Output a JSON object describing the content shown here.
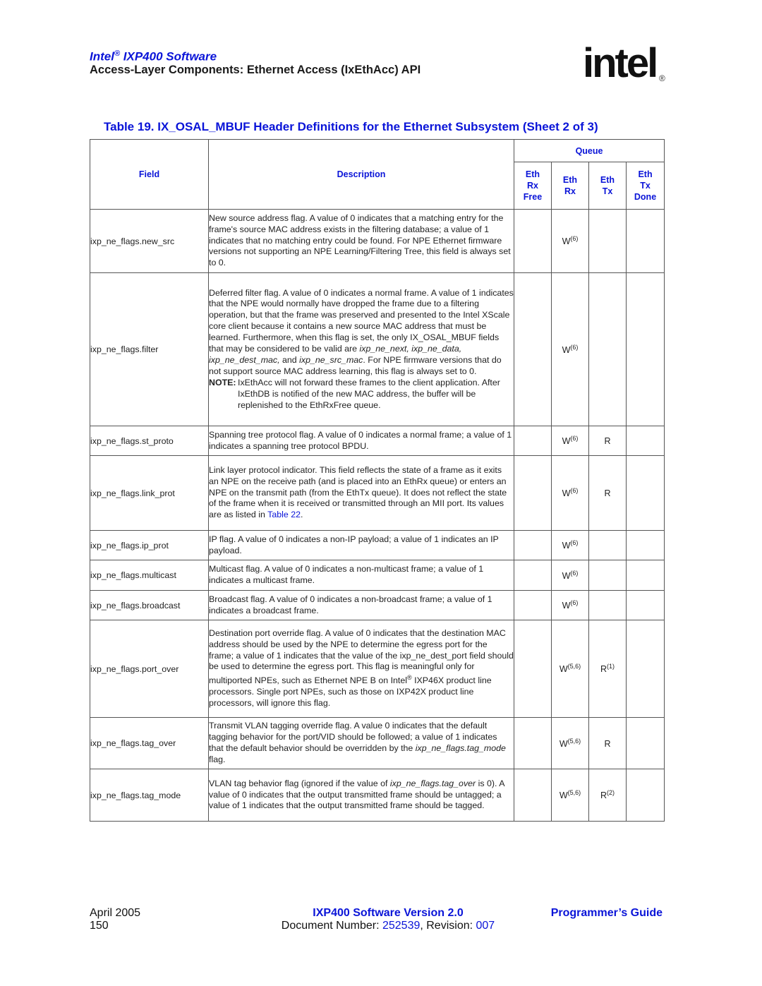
{
  "header": {
    "brand": "Intel",
    "brand_reg": "®",
    "product": " IXP400 Software",
    "subtitle": "Access-Layer Components: Ethernet Access (IxEthAcc) API",
    "logo_text": "intel",
    "logo_reg": "®"
  },
  "table": {
    "title": "Table 19.  IX_OSAL_MBUF Header Definitions for the Ethernet Subsystem (Sheet 2 of 3)",
    "columns": {
      "field": "Field",
      "description": "Description",
      "queue_group": "Queue",
      "queues": [
        [
          "Eth",
          "Rx",
          "Free"
        ],
        [
          "Eth",
          "Rx"
        ],
        [
          "Eth",
          "Tx"
        ],
        [
          "Eth",
          "Tx",
          "Done"
        ]
      ]
    },
    "rows": [
      {
        "field": "ixp_ne_flags.new_src",
        "description": "New source address flag.  A value of 0 indicates that a matching entry for the frame's source MAC address exists in the filtering database;  a value of 1 indicates that no matching entry could be found.  For NPE Ethernet firmware versions not supporting an NPE Learning/Filtering Tree, this field is always set to 0.",
        "queues": [
          {
            "v": "",
            "s": ""
          },
          {
            "v": "W",
            "s": "(6)"
          },
          {
            "v": "",
            "s": ""
          },
          {
            "v": "",
            "s": ""
          }
        ]
      },
      {
        "field": "ixp_ne_flags.filter",
        "description_parts": [
          "Deferred filter flag. A value of 0 indicates a normal frame. A value of 1 indicates that the NPE would normally have dropped the frame due to a filtering operation, but that the frame was preserved and presented to the Intel XScale core client because it contains a new source MAC address that must be learned. Furthermore, when this flag is set, the only IX_OSAL_MBUF fields that may be considered to be valid are ",
          "ixp_ne_next, ixp_ne_data, ixp_ne_dest_mac,",
          " and ",
          "ixp_ne_src_mac",
          ". For NPE firmware versions that do not support source MAC address learning, this flag is always set to 0."
        ],
        "note_label": "NOTE:",
        "note_text": "IxEthAcc will not forward these frames to the client application. After IxEthDB is notified of the new MAC address, the buffer will be replenished to the EthRxFree queue.",
        "queues": [
          {
            "v": "",
            "s": ""
          },
          {
            "v": "W",
            "s": "(6)"
          },
          {
            "v": "",
            "s": ""
          },
          {
            "v": "",
            "s": ""
          }
        ]
      },
      {
        "field": "ixp_ne_flags.st_proto",
        "description": "Spanning tree protocol flag. A value of 0 indicates a normal frame; a value of 1 indicates a spanning tree protocol BPDU.",
        "queues": [
          {
            "v": "",
            "s": ""
          },
          {
            "v": "W",
            "s": "(6)"
          },
          {
            "v": "R",
            "s": ""
          },
          {
            "v": "",
            "s": ""
          }
        ]
      },
      {
        "field": "ixp_ne_flags.link_prot",
        "description": "Link layer protocol indicator. This field reflects the state of a frame as it exits an NPE on the receive path (and is placed into an EthRx queue) or enters an NPE on the transmit path (from the EthTx queue). It does not reflect the state of the frame when it is received or transmitted through an MII port. Its values are as listed in ",
        "link": "Table 22",
        "link_after": ".",
        "queues": [
          {
            "v": "",
            "s": ""
          },
          {
            "v": "W",
            "s": "(6)"
          },
          {
            "v": "R",
            "s": ""
          },
          {
            "v": "",
            "s": ""
          }
        ]
      },
      {
        "field": "ixp_ne_flags.ip_prot",
        "description": "IP flag.  A value of 0 indicates a non-IP payload; a value of 1 indicates an IP payload.",
        "queues": [
          {
            "v": "",
            "s": ""
          },
          {
            "v": "W",
            "s": "(6)"
          },
          {
            "v": "",
            "s": ""
          },
          {
            "v": "",
            "s": ""
          }
        ]
      },
      {
        "field": "ixp_ne_flags.multicast",
        "description": "Multicast flag.  A value of 0 indicates a non-multicast frame; a value of 1 indicates a multicast frame.",
        "queues": [
          {
            "v": "",
            "s": ""
          },
          {
            "v": "W",
            "s": "(6)"
          },
          {
            "v": "",
            "s": ""
          },
          {
            "v": "",
            "s": ""
          }
        ]
      },
      {
        "field": "ixp_ne_flags.broadcast",
        "description": "Broadcast flag.  A value of 0 indicates a non-broadcast frame; a value of 1 indicates a broadcast frame.",
        "queues": [
          {
            "v": "",
            "s": ""
          },
          {
            "v": "W",
            "s": "(6)"
          },
          {
            "v": "",
            "s": ""
          },
          {
            "v": "",
            "s": ""
          }
        ]
      },
      {
        "field": "ixp_ne_flags.port_over",
        "description_a": "Destination port override flag. A value of 0 indicates that the destination MAC address should be used by the NPE to determine the egress port for the frame;  a value of 1 indicates that the value of the ixp_ne_dest_port field should be used to determine the egress port. This flag is meaningful only for multiported NPEs, such as Ethernet NPE B on Intel",
        "description_reg": "®",
        "description_b": " IXP46X product line processors. Single port NPEs, such as those on IXP42X product line processors, will ignore this flag.",
        "queues": [
          {
            "v": "",
            "s": ""
          },
          {
            "v": "W",
            "s": "(5,6)"
          },
          {
            "v": "R",
            "s": "(1)"
          },
          {
            "v": "",
            "s": ""
          }
        ]
      },
      {
        "field": "ixp_ne_flags.tag_over",
        "description_a": "Transmit VLAN tagging override flag.  A value 0 indicates that the default tagging behavior for the port/VID should be followed; a value of 1 indicates that the default behavior should be overridden by the ",
        "description_i": "ixp_ne_flags.tag_mode",
        "description_b": " flag.",
        "queues": [
          {
            "v": "",
            "s": ""
          },
          {
            "v": "W",
            "s": "(5,6)"
          },
          {
            "v": "R",
            "s": ""
          },
          {
            "v": "",
            "s": ""
          }
        ]
      },
      {
        "field": "ixp_ne_flags.tag_mode",
        "description_a": "VLAN tag behavior flag (ignored if the value of ",
        "description_i": "ixp_ne_flags.tag_over",
        "description_b": " is 0). A value of 0 indicates that the output transmitted frame should be untagged; a value of 1 indicates that the output transmitted frame should be tagged.",
        "queues": [
          {
            "v": "",
            "s": ""
          },
          {
            "v": "W",
            "s": "(5,6)"
          },
          {
            "v": "R",
            "s": "(2)"
          },
          {
            "v": "",
            "s": ""
          }
        ]
      }
    ]
  },
  "footer": {
    "date": "April 2005",
    "page": "150",
    "version": "IXP400 Software Version 2.0",
    "doc_label": "Document Number: ",
    "doc_number": "252539",
    "rev_label": ", Revision: ",
    "revision": "007",
    "guide": "Programmer’s Guide"
  }
}
